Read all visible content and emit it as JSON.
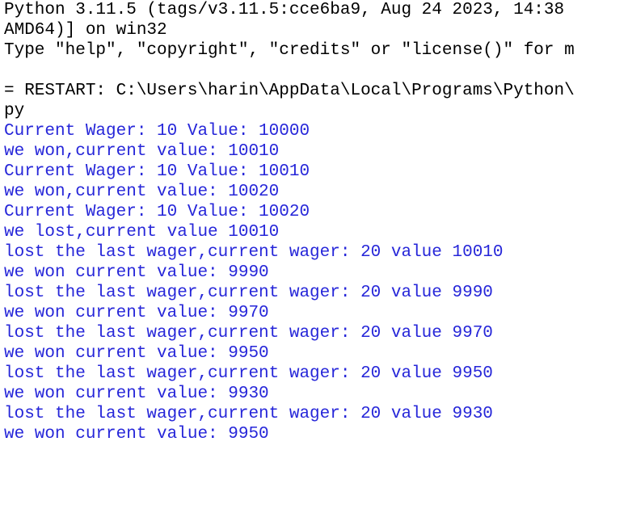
{
  "colors": {
    "background": "#ffffff",
    "system_text": "#000000",
    "program_output": "#2626d9"
  },
  "console": {
    "header_lines": [
      "Python 3.11.5 (tags/v3.11.5:cce6ba9, Aug 24 2023, 14:38",
      "AMD64)] on win32",
      "Type \"help\", \"copyright\", \"credits\" or \"license()\" for m"
    ],
    "restart_lines": [
      "= RESTART: C:\\Users\\harin\\AppData\\Local\\Programs\\Python\\",
      "py"
    ],
    "output_lines": [
      "Current Wager: 10 Value: 10000",
      "we won,current value: 10010",
      "Current Wager: 10 Value: 10010",
      "we won,current value: 10020",
      "Current Wager: 10 Value: 10020",
      "we lost,current value 10010",
      "lost the last wager,current wager: 20 value 10010",
      "we won current value: 9990",
      "lost the last wager,current wager: 20 value 9990",
      "we won current value: 9970",
      "lost the last wager,current wager: 20 value 9970",
      "we won current value: 9950",
      "lost the last wager,current wager: 20 value 9950",
      "we won current value: 9930",
      "lost the last wager,current wager: 20 value 9930",
      "we won current value: 9950"
    ]
  }
}
